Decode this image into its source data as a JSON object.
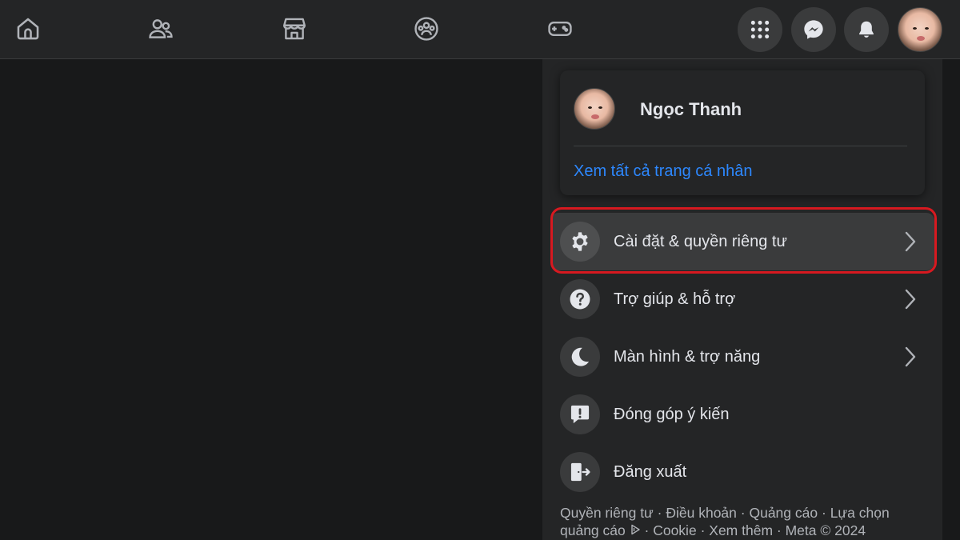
{
  "topbar": {
    "nav_icons": [
      "home-icon",
      "friends-icon",
      "marketplace-icon",
      "groups-icon",
      "gaming-icon"
    ],
    "right_buttons": [
      "menu-grid-icon",
      "messenger-icon",
      "notifications-icon"
    ],
    "accent": "#2d88ff"
  },
  "profile": {
    "name": "Ngọc Thanh",
    "link": "Xem tất cả trang cá nhân"
  },
  "menu": {
    "items": [
      {
        "label": "Cài đặt & quyền riêng tư",
        "icon": "gear-icon",
        "has_arrow": true,
        "highlighted": true
      },
      {
        "label": "Trợ giúp & hỗ trợ",
        "icon": "help-icon",
        "has_arrow": true
      },
      {
        "label": "Màn hình & trợ năng",
        "icon": "moon-icon",
        "has_arrow": true
      },
      {
        "label": "Đóng góp ý kiến",
        "icon": "feedback-icon",
        "has_arrow": false
      },
      {
        "label": "Đăng xuất",
        "icon": "logout-icon",
        "has_arrow": false
      }
    ]
  },
  "footer": {
    "privacy": "Quyền riêng tư",
    "terms": "Điều khoản",
    "ads": "Quảng cáo",
    "adchoices": "Lựa chọn quảng cáo",
    "cookie": "Cookie",
    "more": "Xem thêm",
    "meta": "Meta © 2024",
    "sep": "·"
  },
  "colors": {
    "background": "#18191a",
    "surface": "#242526",
    "highlight_frame": "#d71920"
  }
}
